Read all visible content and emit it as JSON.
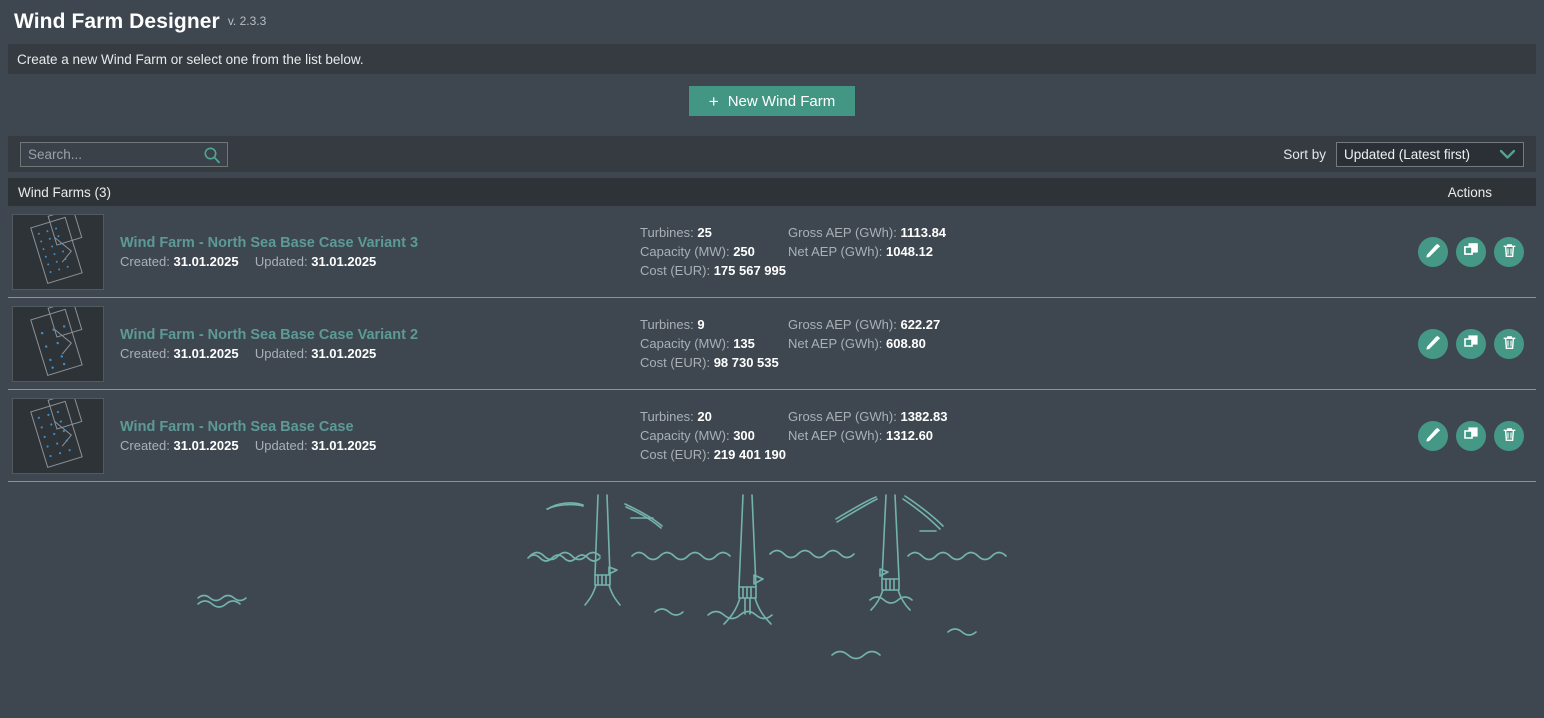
{
  "header": {
    "title": "Wind Farm Designer",
    "version": "v. 2.3.3"
  },
  "banner": {
    "text": "Create a new Wind Farm or select one from the list below."
  },
  "toolbar": {
    "new_button_label": "New Wind Farm",
    "new_button_icon": "plus-icon",
    "search_placeholder": "Search...",
    "search_value": "",
    "search_icon": "search-icon",
    "sort_label": "Sort by",
    "sort_value": "Updated (Latest first)",
    "sort_icon": "chevron-down-icon"
  },
  "table": {
    "title": "Wind Farms (3)",
    "actions_header": "Actions",
    "labels": {
      "created": "Created:",
      "updated": "Updated:",
      "turbines": "Turbines:",
      "capacity": "Capacity (MW):",
      "cost": "Cost (EUR):",
      "gross_aep": "Gross AEP (GWh):",
      "net_aep": "Net AEP (GWh):"
    },
    "action_buttons": [
      {
        "name": "edit-button",
        "icon": "pencil-icon"
      },
      {
        "name": "duplicate-button",
        "icon": "copy-icon"
      },
      {
        "name": "delete-button",
        "icon": "trash-icon"
      }
    ],
    "rows": [
      {
        "name": "Wind Farm - North Sea Base Case Variant 3",
        "created": "31.01.2025",
        "updated": "31.01.2025",
        "turbines": "25",
        "capacity": "250",
        "cost": "175 567 995",
        "gross_aep": "1113.84",
        "net_aep": "1048.12"
      },
      {
        "name": "Wind Farm - North Sea Base Case Variant 2",
        "created": "31.01.2025",
        "updated": "31.01.2025",
        "turbines": "9",
        "capacity": "135",
        "cost": "98 730 535",
        "gross_aep": "622.27",
        "net_aep": "608.80"
      },
      {
        "name": "Wind Farm - North Sea Base Case",
        "created": "31.01.2025",
        "updated": "31.01.2025",
        "turbines": "20",
        "capacity": "300",
        "cost": "219 401 190",
        "gross_aep": "1382.83",
        "net_aep": "1312.60"
      }
    ]
  },
  "colors": {
    "page_background": "#3e4750",
    "panel_background": "#353b41",
    "table_header_background": "#2e3338",
    "accent": "#439684",
    "link": "#5d9a96",
    "illustration_line": "#74b3ad",
    "text_primary": "#ffffff",
    "text_muted": "#a9b0b6"
  },
  "illustration": {
    "name": "offshore-wind-turbines-illustration"
  }
}
